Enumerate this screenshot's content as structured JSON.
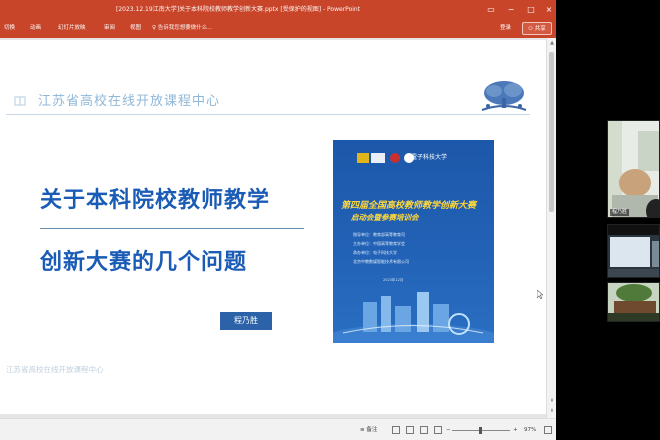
{
  "window": {
    "title": "[2023.12.19江南大学]关于本科院校教师教学创新大赛.pptx [受保护的视图] - PowerPoint",
    "sign_in": "登录",
    "share": "共享",
    "tabs": [
      "切换",
      "动画",
      "幻灯片放映",
      "审阅",
      "视图"
    ],
    "search_placeholder": "告诉我您想要做什么..."
  },
  "slide": {
    "school_header": "江苏省高校在线开放课程中心",
    "heading_line1": "关于本科院校教师教学",
    "heading_line2": "创新大赛的几个问题",
    "presenter": "程乃胜",
    "footer": "江苏省高校在线开放课程中心",
    "poster": {
      "title": "第四届全国高校教师教学创新大赛",
      "subtitle": "启动会暨参赛培训会",
      "orgs": [
        "指导单位：教育部高等教育司",
        "主办单位：中国高等教育学会",
        "承办单位：电子科技大学",
        "北京中教数媒智能技术有限公司"
      ],
      "date": "2023年12月",
      "header_text": "電子科技大学"
    }
  },
  "statusbar": {
    "notes": "备注",
    "zoom": "97%"
  },
  "participants": [
    {
      "name": "程乃胜"
    },
    {
      "name": ""
    },
    {
      "name": ""
    }
  ],
  "colors": {
    "ribbon": "#c8452a",
    "heading": "#1a5bb5",
    "poster": "#1d57a9",
    "poster_title": "#ffd83b"
  }
}
